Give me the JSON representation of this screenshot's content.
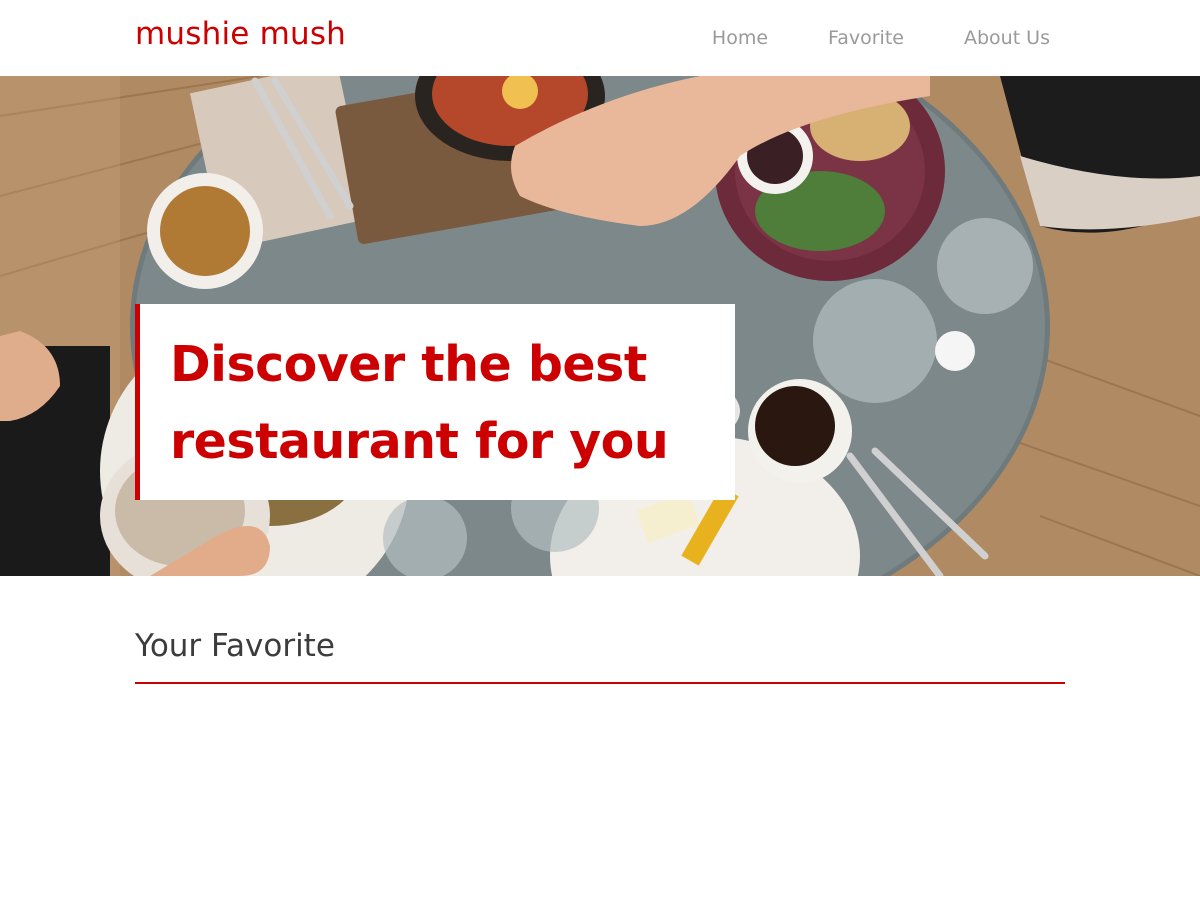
{
  "header": {
    "brand": "mushie mush",
    "nav": [
      {
        "label": "Home"
      },
      {
        "label": "Favorite"
      },
      {
        "label": "About Us"
      }
    ]
  },
  "hero": {
    "title_line1": "Discover the best",
    "title_line2": "restaurant for you"
  },
  "favorite": {
    "heading": "Your Favorite"
  },
  "colors": {
    "accent": "#cc0000",
    "nav_text": "#9a9a9a",
    "heading_text": "#3c3c3c"
  }
}
